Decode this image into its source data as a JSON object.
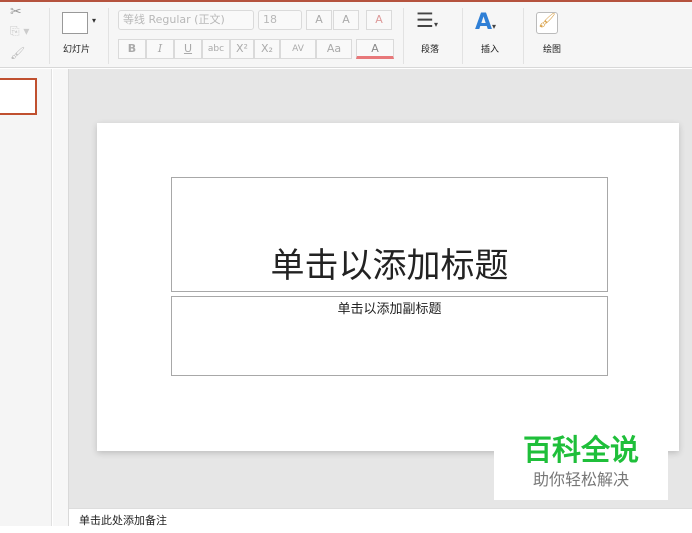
{
  "toolbar": {
    "slide_label": "幻灯片",
    "font_name": "等线 Regular (正文)",
    "font_size": "18",
    "grow_font": "A",
    "shrink_font": "A",
    "bold": "B",
    "italic": "I",
    "underline": "U",
    "strikethrough": "abc",
    "superscript": "X²",
    "subscript": "X₂",
    "char_spacing": "AV",
    "change_case": "Aa",
    "font_color": "A",
    "paragraph_label": "段落",
    "insert_label": "插入",
    "draw_label": "绘图"
  },
  "slide": {
    "title_placeholder": "单击以添加标题",
    "subtitle_placeholder": "单击以添加副标题"
  },
  "notes": {
    "placeholder": "单击此处添加备注"
  },
  "watermark": {
    "title": "百科全说",
    "subtitle": "助你轻松解决",
    "color": "#1fbf3a"
  },
  "colors": {
    "accent": "#c0502f",
    "font_color_bar": "#e8787a"
  }
}
